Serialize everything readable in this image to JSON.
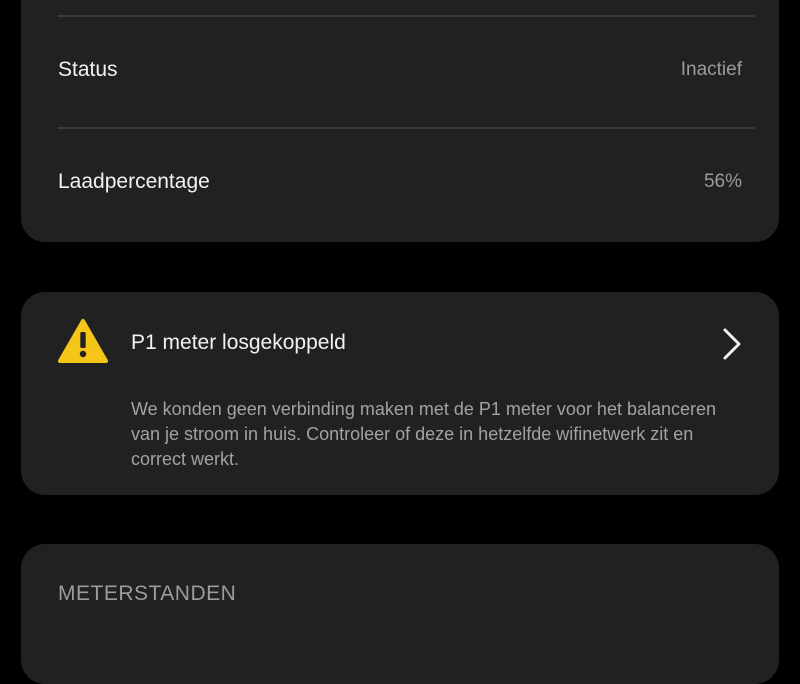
{
  "status_card": {
    "rows": [
      {
        "label": "Status",
        "value": "Inactief"
      },
      {
        "label": "Laadpercentage",
        "value": "56%"
      }
    ]
  },
  "alert": {
    "icon": "warning-icon",
    "title": "P1 meter losgekoppeld",
    "message": "We konden geen verbinding maken met de P1 meter voor het balanceren van je stroom in huis. Controleer of deze in hetzelfde wifinetwerk zit en correct werkt.",
    "icon_color": "#F5C518"
  },
  "meterstanden": {
    "header": "METERSTANDEN"
  },
  "colors": {
    "background": "#000000",
    "card": "#212121",
    "divider": "#3a3a3a",
    "secondary_text": "#9b9b9b"
  }
}
